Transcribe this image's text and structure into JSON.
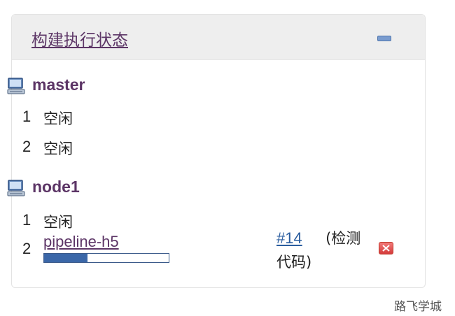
{
  "panel": {
    "title": "构建执行状态",
    "collapse_icon": "minimize-icon"
  },
  "nodes": [
    {
      "name": "master",
      "icon": "computer-icon",
      "executors": [
        {
          "number": "1",
          "state": "空闲"
        },
        {
          "number": "2",
          "state": "空闲"
        }
      ]
    },
    {
      "name": "node1",
      "icon": "computer-icon",
      "executors": [
        {
          "number": "1",
          "state": "空闲"
        },
        {
          "number": "2",
          "job": "pipeline-h5",
          "progress_fraction": 0.35,
          "build_number": "#14",
          "build_desc": "(检测代码)",
          "stop_icon": "stop-icon"
        }
      ]
    }
  ],
  "watermark": "路飞学城",
  "colors": {
    "link_purple": "#5c3566",
    "link_blue": "#2a5d9f",
    "progress_fill": "#3b67a8",
    "header_bg": "#eeeeee"
  }
}
